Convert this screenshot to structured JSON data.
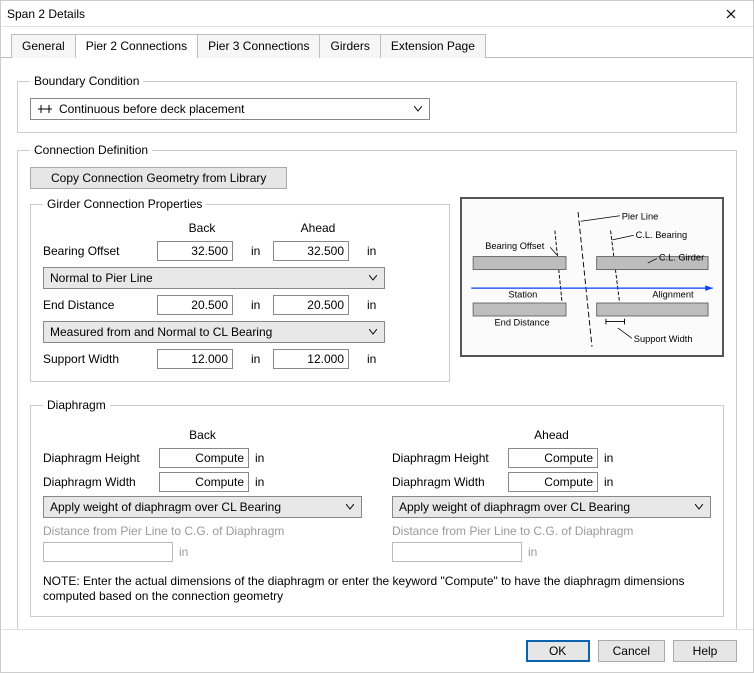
{
  "window": {
    "title": "Span 2 Details"
  },
  "tabs": [
    {
      "label": "General"
    },
    {
      "label": "Pier 2 Connections"
    },
    {
      "label": "Pier 3 Connections"
    },
    {
      "label": "Girders"
    },
    {
      "label": "Extension Page"
    }
  ],
  "boundary": {
    "legend": "Boundary Condition",
    "value": "Continuous before deck placement"
  },
  "connection": {
    "legend": "Connection Definition",
    "copy_btn": "Copy Connection Geometry from Library",
    "gcp": {
      "legend": "Girder Connection Properties",
      "back_head": "Back",
      "ahead_head": "Ahead",
      "bearing_offset_lbl": "Bearing Offset",
      "bearing_offset_back": "32.500",
      "bearing_offset_ahead": "32.500",
      "select_offset": "Normal to Pier Line",
      "end_distance_lbl": "End Distance",
      "end_distance_back": "20.500",
      "end_distance_ahead": "20.500",
      "select_end": "Measured from and Normal to CL Bearing",
      "support_width_lbl": "Support Width",
      "support_width_back": "12.000",
      "support_width_ahead": "12.000",
      "unit": "in"
    },
    "diagram": {
      "pier_line": "Pier Line",
      "cl_bearing": "C.L. Bearing",
      "cl_girder": "C.L. Girder",
      "bearing_offset": "Bearing Offset",
      "station": "Station",
      "alignment": "Alignment",
      "end_distance": "End Distance",
      "support_width": "Support Width"
    }
  },
  "diaphragm": {
    "legend": "Diaphragm",
    "back_head": "Back",
    "ahead_head": "Ahead",
    "height_lbl": "Diaphragm Height",
    "width_lbl": "Diaphragm Width",
    "compute": "Compute",
    "unit": "in",
    "select_back": "Apply weight of diaphragm over CL Bearing",
    "select_ahead": "Apply weight of diaphragm over CL Bearing",
    "dist_lbl": "Distance from Pier Line to C.G. of Diaphragm",
    "note": "NOTE: Enter the actual dimensions of the diaphragm or enter the keyword \"Compute\" to have the diaphragm dimensions computed based on the connection geometry"
  },
  "buttons": {
    "ok": "OK",
    "cancel": "Cancel",
    "help": "Help"
  }
}
